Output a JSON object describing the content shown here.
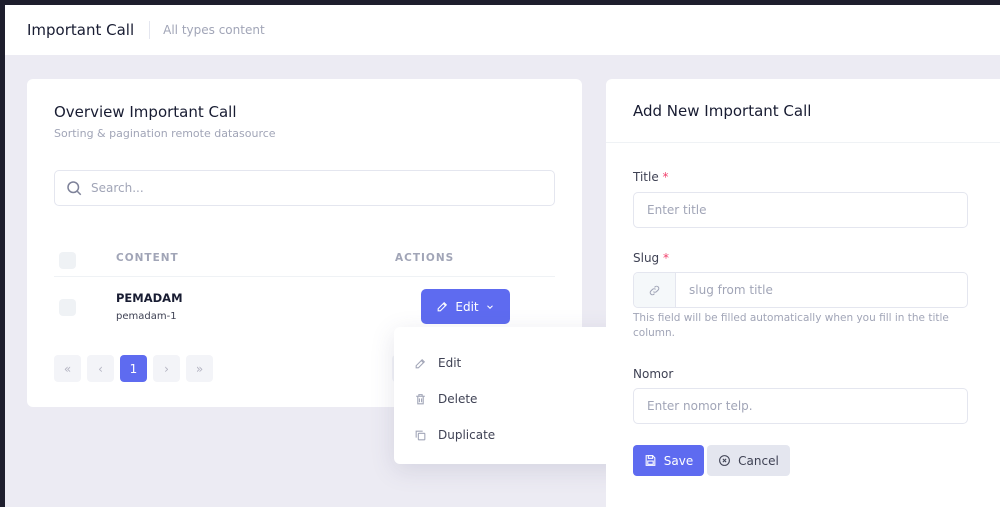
{
  "header": {
    "title": "Important Call",
    "subtitle": "All types content"
  },
  "overview": {
    "title": "Overview Important Call",
    "subtitle": "Sorting & pagination remote datasource",
    "search": {
      "placeholder": "Search..."
    },
    "columns": {
      "content": "CONTENT",
      "actions": "ACTIONS"
    },
    "rows": [
      {
        "name": "PEMADAM",
        "slug": "pemadam-1",
        "action_label": "Edit"
      }
    ],
    "pagination": {
      "first": "«",
      "prev": "‹",
      "current": "1",
      "next": "›",
      "last": "»"
    }
  },
  "dropdown": {
    "items": [
      {
        "label": "Edit",
        "icon": "pencil-icon"
      },
      {
        "label": "Delete",
        "icon": "trash-icon"
      },
      {
        "label": "Duplicate",
        "icon": "copy-icon"
      }
    ]
  },
  "form": {
    "title": "Add New Important Call",
    "title_field": {
      "label": "Title",
      "required_mark": "*",
      "placeholder": "Enter title"
    },
    "slug_field": {
      "label": "Slug",
      "required_mark": "*",
      "placeholder": "slug from title",
      "hint": "This field will be filled automatically when you fill in the title column."
    },
    "nomor_field": {
      "label": "Nomor",
      "placeholder": "Enter nomor telp."
    },
    "save_label": "Save",
    "cancel_label": "Cancel"
  },
  "colors": {
    "primary": "#5e6bf0",
    "background": "#ecebf3",
    "required": "#f1416c"
  }
}
